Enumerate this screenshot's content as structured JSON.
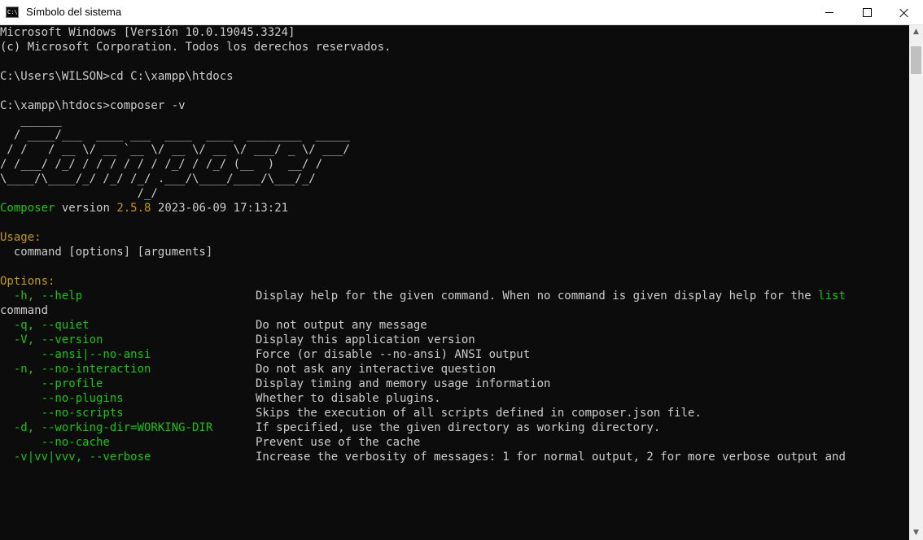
{
  "window": {
    "title": "Símbolo del sistema",
    "icon_name": "cmd-icon",
    "icon_text": "C:\\",
    "controls": {
      "minimize": "minimize-icon",
      "maximize": "maximize-icon",
      "close": "close-icon"
    }
  },
  "colors": {
    "background": "#0c0c0c",
    "text": "#cccccc",
    "green": "#16c60c",
    "yellow": "#c19c00"
  },
  "console": {
    "header1": "Microsoft Windows [Versión 10.0.19045.3324]",
    "header2": "(c) Microsoft Corporation. Todos los derechos reservados.",
    "cmd1": "C:\\Users\\WILSON>cd C:\\xampp\\htdocs",
    "cmd2": "C:\\xampp\\htdocs>composer -v",
    "logo": [
      "   ______",
      "  / ____/___  ____ ___  ____  ____  ________  _____",
      " / /   / __ \\/ __ `__ \\/ __ \\/ __ \\/ ___/ _ \\/ ___/",
      "/ /___/ /_/ / / / / / / /_/ / /_/ (__  )  __/ /",
      "\\____/\\____/_/ /_/ /_/ .___/\\____/____/\\___/_/",
      "                    /_/"
    ],
    "version": {
      "name": "Composer",
      "label": "version",
      "number": "2.5.8",
      "datetime": "2023-06-09 17:13:21"
    },
    "usage_title": "Usage:",
    "usage_text": "  command [options] [arguments]",
    "options_title": "Options:",
    "help_option": "  -h, --help",
    "help_desc": "Display help for the given command. When no command is given display help for the ",
    "help_link": "list",
    "help_cont": "command",
    "options": [
      {
        "flag": "  -q, --quiet",
        "desc": "Do not output any message"
      },
      {
        "flag": "  -V, --version",
        "desc": "Display this application version"
      },
      {
        "flag": "      --ansi|--no-ansi",
        "desc": "Force (or disable --no-ansi) ANSI output"
      },
      {
        "flag": "  -n, --no-interaction",
        "desc": "Do not ask any interactive question"
      },
      {
        "flag": "      --profile",
        "desc": "Display timing and memory usage information"
      },
      {
        "flag": "      --no-plugins",
        "desc": "Whether to disable plugins."
      },
      {
        "flag": "      --no-scripts",
        "desc": "Skips the execution of all scripts defined in composer.json file."
      },
      {
        "flag": "  -d, --working-dir=WORKING-DIR",
        "desc": "If specified, use the given directory as working directory."
      },
      {
        "flag": "      --no-cache",
        "desc": "Prevent use of the cache"
      },
      {
        "flag": "  -v|vv|vvv, --verbose",
        "desc": "Increase the verbosity of messages: 1 for normal output, 2 for more verbose output and"
      }
    ]
  },
  "scrollbar": {
    "up": "▲",
    "down": "▼"
  }
}
